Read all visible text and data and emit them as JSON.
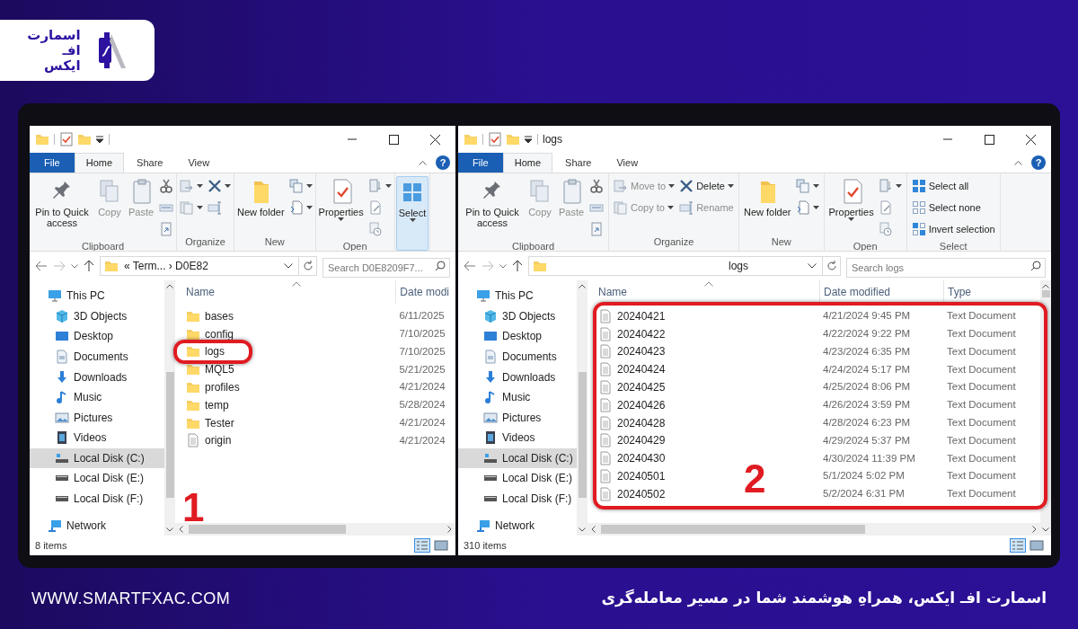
{
  "logo": {
    "lines": [
      "اسمارت",
      "افـ",
      "ایکس"
    ]
  },
  "windows": [
    {
      "file_button": "File",
      "tabs": [
        {
          "label": "Home",
          "selected": true
        },
        {
          "label": "Share",
          "selected": false
        },
        {
          "label": "View",
          "selected": false
        }
      ],
      "help": "?",
      "ribbon": [
        {
          "label": "Clipboard",
          "items": [
            {
              "kind": "large",
              "label": "Pin to Quick access",
              "disabled": false
            },
            {
              "kind": "large",
              "label": "Copy",
              "disabled": true
            },
            {
              "kind": "large",
              "label": "Paste",
              "disabled": true
            },
            {
              "kind": "stack",
              "items": [
                {
                  "kind": "small"
                },
                {
                  "kind": "small"
                },
                {
                  "kind": "small"
                }
              ]
            }
          ]
        },
        {
          "label": "Organize",
          "items": [
            {
              "kind": "stack",
              "items": [
                {
                  "kind": "small",
                  "dropdown": true
                },
                {
                  "kind": "small",
                  "dropdown": true
                }
              ]
            },
            {
              "kind": "stack",
              "items": [
                {
                  "kind": "small",
                  "dropdown": true
                },
                {
                  "kind": "small"
                }
              ]
            }
          ]
        },
        {
          "label": "New",
          "items": [
            {
              "kind": "large",
              "label": "New folder",
              "disabled": false
            },
            {
              "kind": "stack",
              "items": [
                {
                  "kind": "small",
                  "dropdown": true
                },
                {
                  "kind": "small",
                  "dropdown": true
                }
              ]
            }
          ]
        },
        {
          "label": "Open",
          "items": [
            {
              "kind": "large",
              "label": "Properties",
              "dropdown": true,
              "disabled": false
            },
            {
              "kind": "stack",
              "items": [
                {
                  "kind": "small",
                  "dropdown": true
                },
                {
                  "kind": "small"
                },
                {
                  "kind": "small"
                }
              ]
            }
          ]
        },
        {
          "items": [
            {
              "kind": "large",
              "label": "Select",
              "dropdown": true,
              "selected": true,
              "disabled": false
            }
          ]
        }
      ],
      "address": {
        "path": "« Term... › D0E82"
      },
      "search": {
        "placeholder": "Search D0E8209F7..."
      },
      "nav": [
        {
          "label": "This PC",
          "selected": false
        },
        {
          "label": "3D Objects",
          "selected": false
        },
        {
          "label": "Desktop",
          "selected": false
        },
        {
          "label": "Documents",
          "selected": false
        },
        {
          "label": "Downloads",
          "selected": false
        },
        {
          "label": "Music",
          "selected": false
        },
        {
          "label": "Pictures",
          "selected": false
        },
        {
          "label": "Videos",
          "selected": false
        },
        {
          "label": "Local Disk (C:)",
          "selected": true
        },
        {
          "label": "Local Disk (E:)",
          "selected": false
        },
        {
          "label": "Local Disk (F:)",
          "selected": false
        },
        {
          "label": "Network",
          "selected": false
        }
      ],
      "columns": [
        "Name",
        "Date modi"
      ],
      "rows": [
        {
          "kind": "folder",
          "name": "bases",
          "date": "6/11/2025"
        },
        {
          "kind": "folder",
          "name": "config",
          "date": "7/10/2025"
        },
        {
          "kind": "folder",
          "name": "logs",
          "date": "7/10/2025"
        },
        {
          "kind": "folder",
          "name": "MQL5",
          "date": "5/21/2025"
        },
        {
          "kind": "folder",
          "name": "profiles",
          "date": "4/21/2024"
        },
        {
          "kind": "folder",
          "name": "temp",
          "date": "5/28/2024"
        },
        {
          "kind": "folder",
          "name": "Tester",
          "date": "4/21/2024"
        },
        {
          "kind": "file",
          "name": "origin",
          "date": "4/21/2024"
        }
      ],
      "status": "8 items"
    },
    {
      "title": "logs",
      "file_button": "File",
      "tabs": [
        {
          "label": "Home",
          "selected": true
        },
        {
          "label": "Share",
          "selected": false
        },
        {
          "label": "View",
          "selected": false
        }
      ],
      "help": "?",
      "ribbon": [
        {
          "label": "Clipboard",
          "items": [
            {
              "kind": "large",
              "label": "Pin to Quick access",
              "disabled": false
            },
            {
              "kind": "large",
              "label": "Copy",
              "disabled": true
            },
            {
              "kind": "large",
              "label": "Paste",
              "disabled": true
            },
            {
              "kind": "stack",
              "items": [
                {
                  "kind": "small"
                },
                {
                  "kind": "small"
                },
                {
                  "kind": "small"
                }
              ]
            }
          ]
        },
        {
          "label": "Organize",
          "items": [
            {
              "kind": "stack",
              "items": [
                {
                  "kind": "small",
                  "label": "Move to",
                  "dropdown": true,
                  "disabled": true
                },
                {
                  "kind": "small",
                  "label": "Copy to",
                  "dropdown": true,
                  "disabled": true
                }
              ]
            },
            {
              "kind": "stack",
              "items": [
                {
                  "kind": "small",
                  "label": "Delete",
                  "dropdown": true,
                  "disabled": false
                },
                {
                  "kind": "small",
                  "label": "Rename",
                  "disabled": true
                }
              ]
            }
          ]
        },
        {
          "label": "New",
          "items": [
            {
              "kind": "large",
              "label": "New folder",
              "disabled": false
            },
            {
              "kind": "stack",
              "items": [
                {
                  "kind": "small",
                  "dropdown": true
                },
                {
                  "kind": "small",
                  "dropdown": true
                }
              ]
            }
          ]
        },
        {
          "label": "Open",
          "items": [
            {
              "kind": "large",
              "label": "Properties",
              "dropdown": true,
              "disabled": false
            },
            {
              "kind": "stack",
              "items": [
                {
                  "kind": "small",
                  "dropdown": true
                },
                {
                  "kind": "small"
                },
                {
                  "kind": "small"
                }
              ]
            }
          ]
        },
        {
          "label": "Select",
          "items": [
            {
              "kind": "stack",
              "items": [
                {
                  "kind": "small",
                  "label": "Select all",
                  "disabled": false
                },
                {
                  "kind": "small",
                  "label": "Select none",
                  "disabled": false
                },
                {
                  "kind": "small",
                  "label": "Invert selection",
                  "disabled": false
                }
              ]
            }
          ]
        }
      ],
      "address": {
        "path": "logs"
      },
      "search": {
        "placeholder": "Search logs"
      },
      "nav": [
        {
          "label": "This PC",
          "selected": false
        },
        {
          "label": "3D Objects",
          "selected": false
        },
        {
          "label": "Desktop",
          "selected": false
        },
        {
          "label": "Documents",
          "selected": false
        },
        {
          "label": "Downloads",
          "selected": false
        },
        {
          "label": "Music",
          "selected": false
        },
        {
          "label": "Pictures",
          "selected": false
        },
        {
          "label": "Videos",
          "selected": false
        },
        {
          "label": "Local Disk (C:)",
          "selected": true
        },
        {
          "label": "Local Disk (E:)",
          "selected": false
        },
        {
          "label": "Local Disk (F:)",
          "selected": false
        },
        {
          "label": "Network",
          "selected": false
        }
      ],
      "columns": [
        "Name",
        "Date modified",
        "Type"
      ],
      "rows": [
        {
          "kind": "file",
          "name": "20240421",
          "date": "4/21/2024 9:45 PM",
          "type": "Text Document"
        },
        {
          "kind": "file",
          "name": "20240422",
          "date": "4/22/2024 9:22 PM",
          "type": "Text Document"
        },
        {
          "kind": "file",
          "name": "20240423",
          "date": "4/23/2024 6:35 PM",
          "type": "Text Document"
        },
        {
          "kind": "file",
          "name": "20240424",
          "date": "4/24/2024 5:17 PM",
          "type": "Text Document"
        },
        {
          "kind": "file",
          "name": "20240425",
          "date": "4/25/2024 8:06 PM",
          "type": "Text Document"
        },
        {
          "kind": "file",
          "name": "20240426",
          "date": "4/26/2024 3:59 PM",
          "type": "Text Document"
        },
        {
          "kind": "file",
          "name": "20240428",
          "date": "4/28/2024 6:23 PM",
          "type": "Text Document"
        },
        {
          "kind": "file",
          "name": "20240429",
          "date": "4/29/2024 5:37 PM",
          "type": "Text Document"
        },
        {
          "kind": "file",
          "name": "20240430",
          "date": "4/30/2024 11:39 PM",
          "type": "Text Document"
        },
        {
          "kind": "file",
          "name": "20240501",
          "date": "5/1/2024 5:02 PM",
          "type": "Text Document"
        },
        {
          "kind": "file",
          "name": "20240502",
          "date": "5/2/2024 6:31 PM",
          "type": "Text Document"
        }
      ],
      "status": "310 items"
    }
  ],
  "callouts": [
    {
      "number": "1"
    },
    {
      "number": "2"
    }
  ],
  "footer": {
    "website": "WWW.SMARTFXAC.COM",
    "tagline": "اسمارت افـ ایکس، همراهِ هوشمند شما در مسیر معامله‌گری"
  }
}
